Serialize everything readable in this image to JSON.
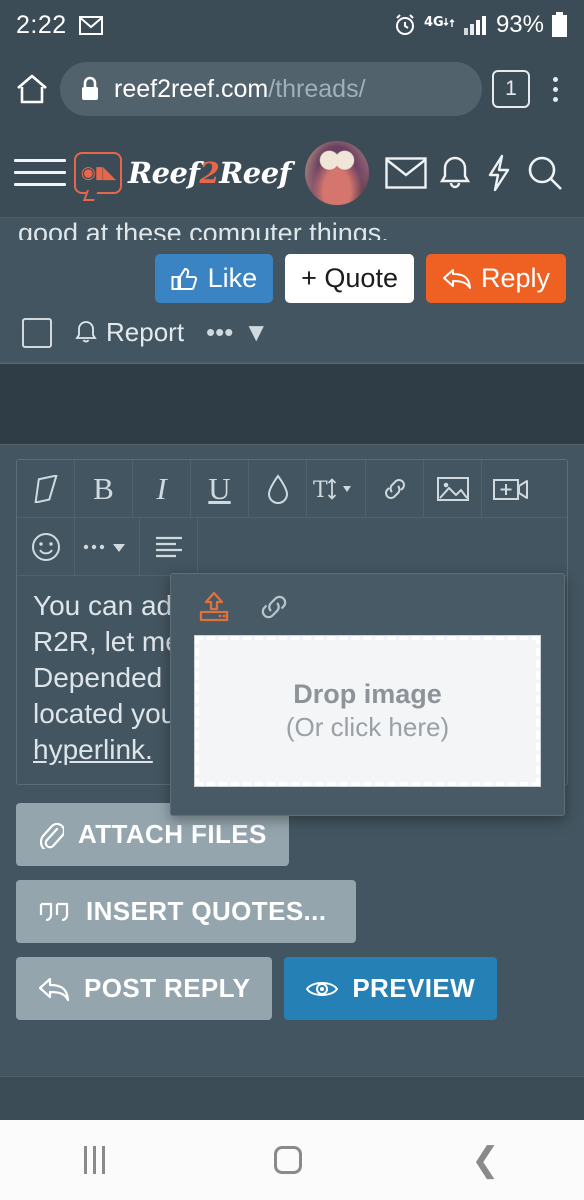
{
  "status_bar": {
    "time": "2:22",
    "gmail_icon": "gmail-icon",
    "alarm_icon": "alarm-icon",
    "network": "4G",
    "signal_icon": "signal-bars-icon",
    "battery_percent": "93%",
    "battery_icon": "battery-icon"
  },
  "browser": {
    "home_icon": "home-icon",
    "lock_icon": "lock-icon",
    "url_domain": "reef2reef.com",
    "url_path": "/threads/",
    "tab_count": "1",
    "menu_icon": "kebab-menu-icon"
  },
  "site_header": {
    "menu_icon": "hamburger-menu-icon",
    "logo_text_1": "Reef",
    "logo_text_2": "2",
    "logo_text_3": "Reef",
    "logo_fish_icon": "clownfish-logo-icon",
    "avatar": "user-avatar",
    "inbox_icon": "envelope-icon",
    "alerts_icon": "bell-icon",
    "whats_new_icon": "lightning-bolt-icon",
    "search_icon": "search-icon"
  },
  "post": {
    "text_fragment": "good at these computer things.",
    "like_label": "Like",
    "like_icon": "thumbs-up-icon",
    "quote_label": "+ Quote",
    "reply_label": "Reply",
    "reply_icon": "reply-arrow-icon",
    "report_label": "Report",
    "report_icon": "bell-icon",
    "more_label": "•••",
    "more_chevron": "▼",
    "select_checkbox": "post-select-checkbox",
    "colors": {
      "like": "#3b84c4",
      "quote_bg": "#ffffff",
      "reply": "#ee6123"
    }
  },
  "editor": {
    "toolbar_row1": [
      {
        "name": "remove-formatting-icon",
        "glyph": "◇"
      },
      {
        "name": "bold-icon",
        "glyph": "B"
      },
      {
        "name": "italic-icon",
        "glyph": "I"
      },
      {
        "name": "underline-icon",
        "glyph": "U"
      },
      {
        "name": "text-color-icon",
        "glyph": "◇"
      },
      {
        "name": "font-size-icon",
        "glyph": "T↕"
      },
      {
        "name": "insert-link-icon",
        "glyph": "🔗"
      },
      {
        "name": "insert-image-icon",
        "glyph": "⛰"
      },
      {
        "name": "insert-video-icon",
        "glyph": "⊞"
      }
    ],
    "toolbar_row2": [
      {
        "name": "emoji-icon",
        "glyph": "☺"
      },
      {
        "name": "more-options-icon",
        "glyph": "•••"
      },
      {
        "name": "text-align-icon",
        "glyph": "≡"
      }
    ],
    "content_lines": [
      "You can ad",
      "R2R, let me",
      "Depended",
      "located you",
      "hyperlink."
    ],
    "content_underlined_line": "hyperlink."
  },
  "image_popup": {
    "upload_tab_icon": "upload-image-icon",
    "link_tab_icon": "image-by-url-icon",
    "drop_title": "Drop image",
    "drop_subtitle": "(Or click here)",
    "accent_color": "#e2703a"
  },
  "actions": {
    "attach_files_label": "ATTACH FILES",
    "attach_files_icon": "paperclip-icon",
    "insert_quotes_label": "INSERT QUOTES...",
    "insert_quotes_icon": "quote-marks-icon",
    "post_reply_label": "POST REPLY",
    "post_reply_icon": "reply-arrow-icon",
    "preview_label": "PREVIEW",
    "preview_icon": "eye-icon",
    "preview_color": "#2580b5"
  },
  "android_nav": {
    "recents_icon": "recents-icon",
    "home_icon": "home-circle-icon",
    "back_icon": "back-chevron-icon"
  }
}
